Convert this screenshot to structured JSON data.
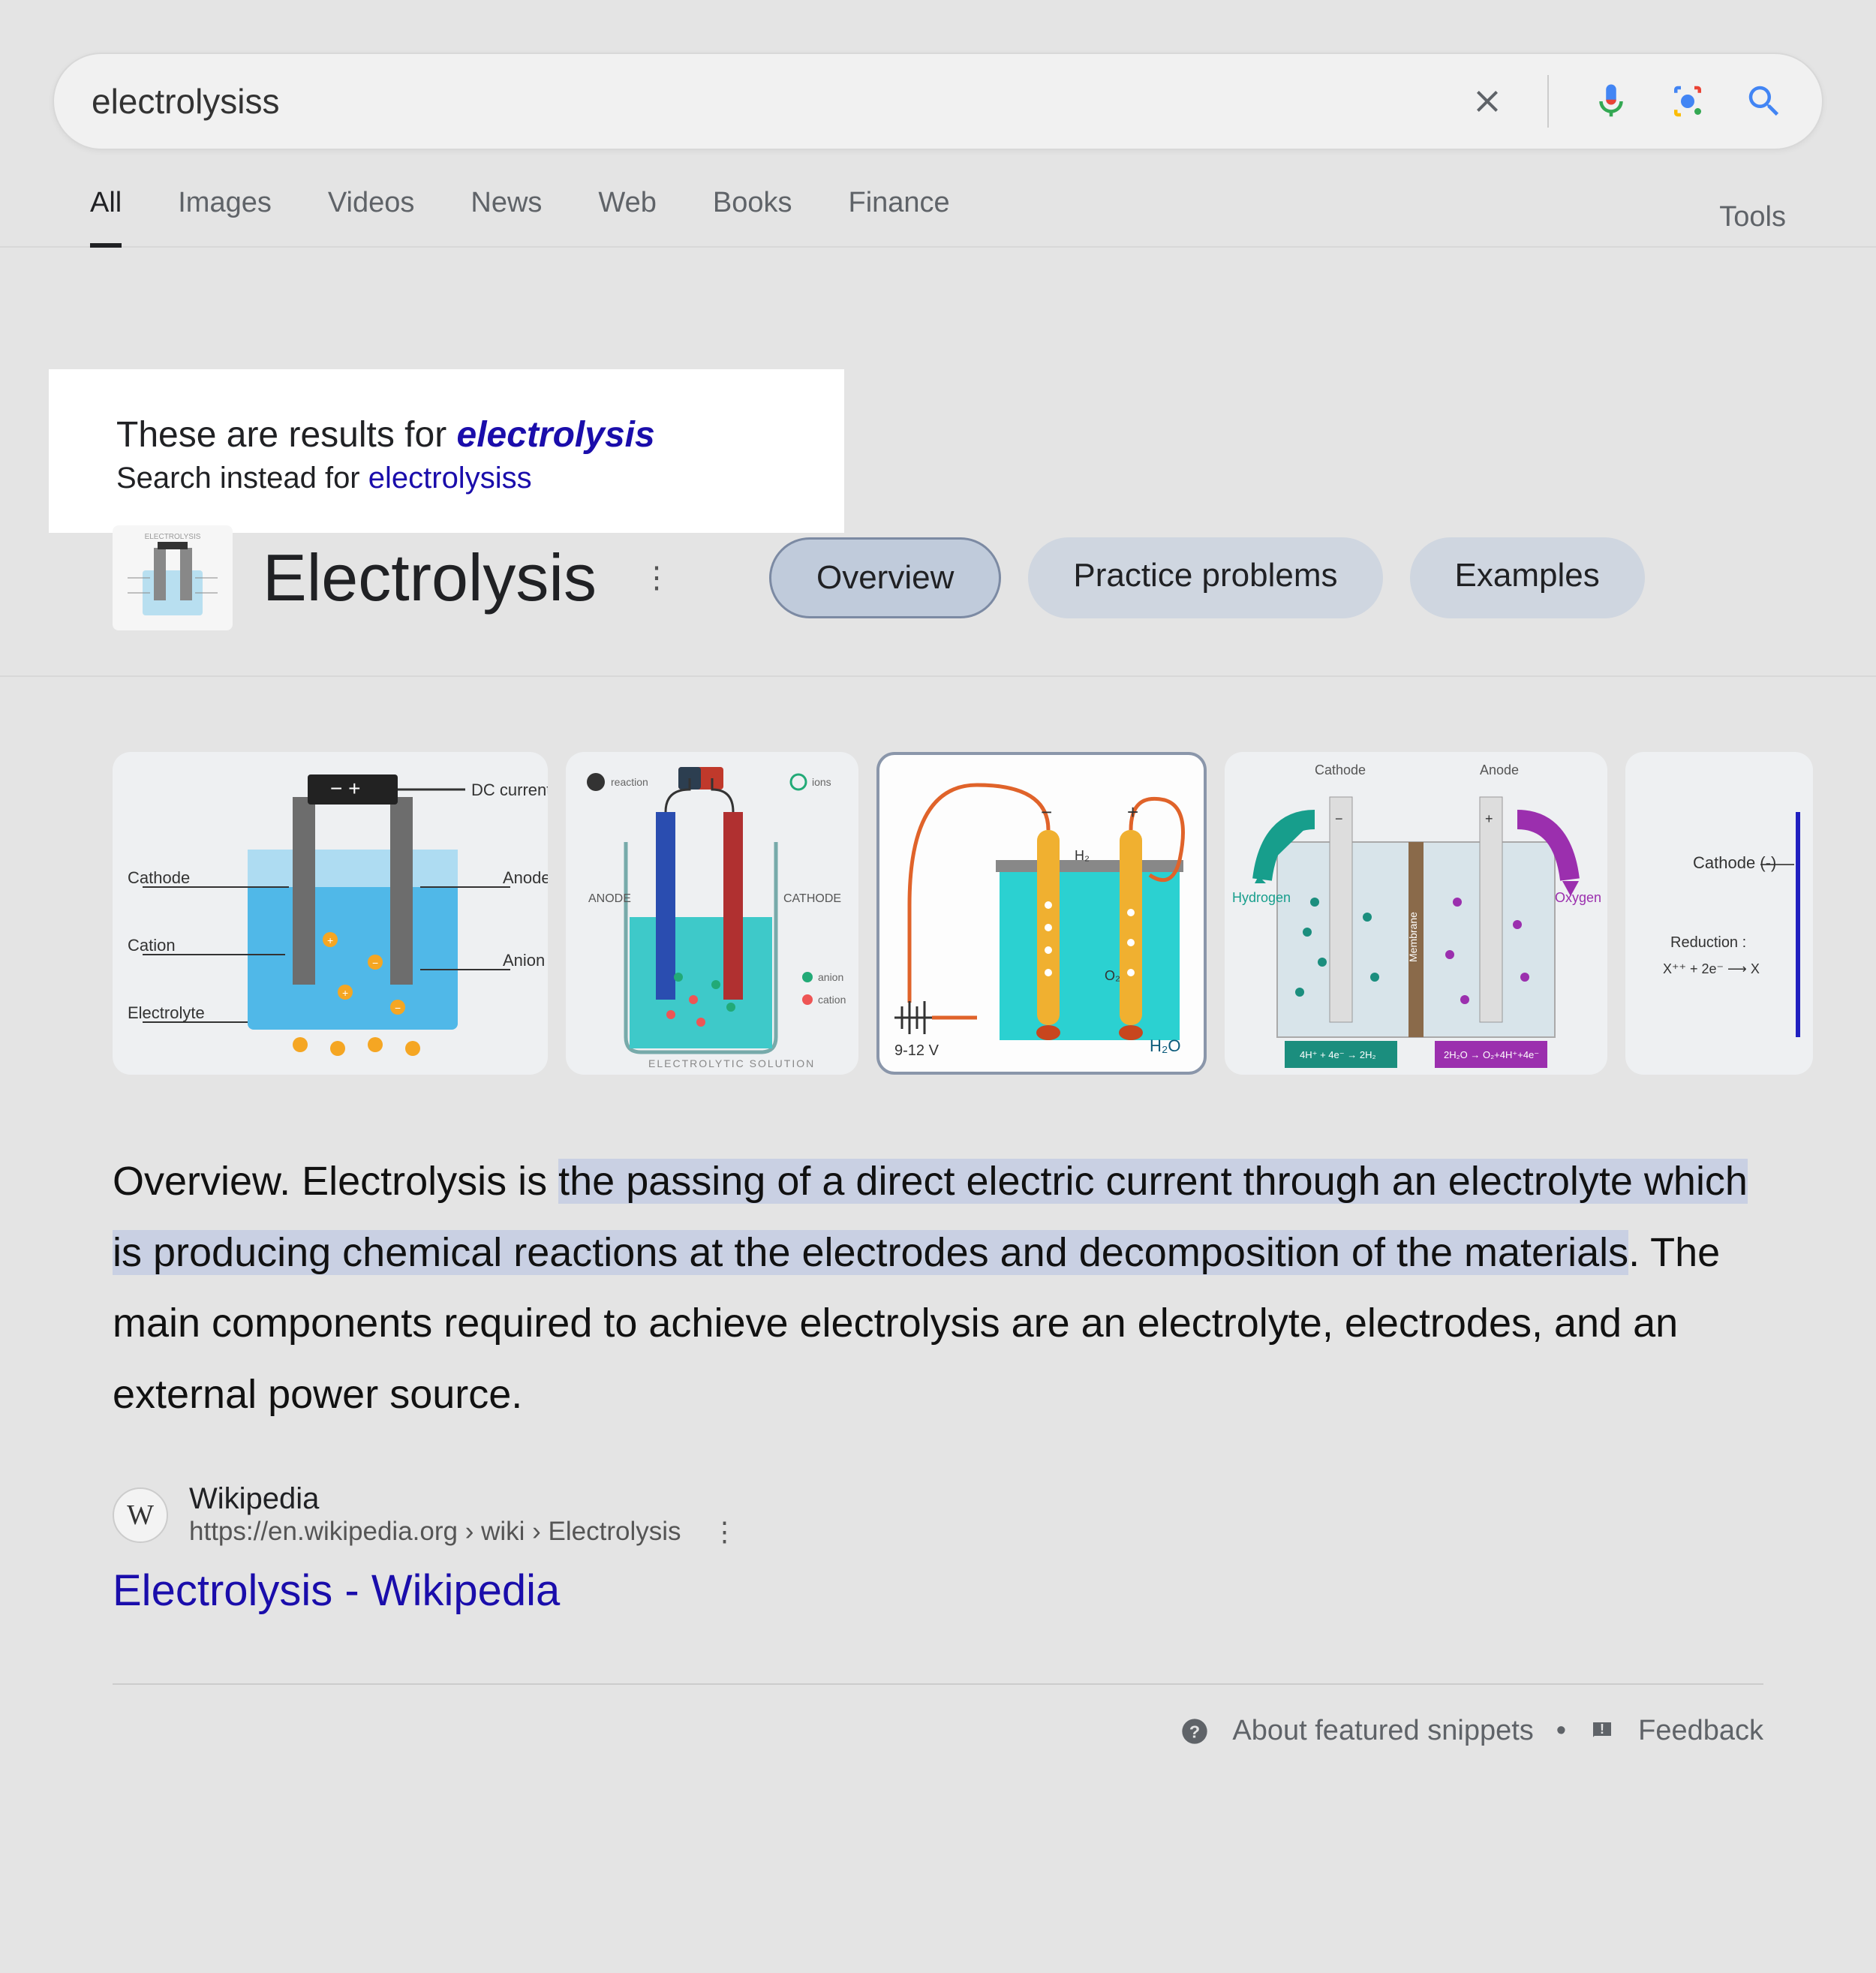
{
  "search": {
    "query": "electrolysiss"
  },
  "tabs": [
    "All",
    "Images",
    "Videos",
    "News",
    "Web",
    "Books",
    "Finance"
  ],
  "tools_label": "Tools",
  "spell": {
    "prefix": "These are results for ",
    "corrected": "electrolysis",
    "line2_prefix": "Search instead for ",
    "original": "electrolysiss"
  },
  "kp": {
    "title": "Electrolysis",
    "chips": [
      "Overview",
      "Practice problems",
      "Examples"
    ]
  },
  "snippet": {
    "pre": "Overview. Electrolysis is ",
    "hl": "the passing of a direct electric current through an electrolyte which is producing chemical reactions at the electrodes and decomposition of the materials",
    "post": ". The main components required to achieve electrolysis are an electrolyte, electrodes, and an external power source."
  },
  "source": {
    "name": "Wikipedia",
    "url_display": "https://en.wikipedia.org › wiki › Electrolysis",
    "result_title": "Electrolysis - Wikipedia"
  },
  "footer": {
    "about": "About featured snippets",
    "feedback": "Feedback"
  },
  "image_labels": {
    "img1": {
      "dc": "DC current",
      "cathode": "Cathode",
      "anode": "Anode",
      "cation": "Cation",
      "anion": "Anion",
      "electrolyte": "Electrolyte"
    },
    "img2": {
      "anode": "ANODE",
      "cathode": "CATHODE",
      "sol": "ELECTROLYTIC  SOLUTION"
    },
    "img3": {
      "volt": "9-12 V",
      "h2o": "H₂O",
      "h2": "H₂",
      "o2": "O₂"
    },
    "img4": {
      "cathode": "Cathode",
      "anode": "Anode",
      "hydrogen": "Hydrogen",
      "oxygen": "Oxygen",
      "membrane": "Membrane"
    },
    "img5": {
      "cathode": "Cathode (-)",
      "reduction": "Reduction :",
      "eq": "X⁺⁺ + 2e⁻ ⟶ X"
    }
  }
}
